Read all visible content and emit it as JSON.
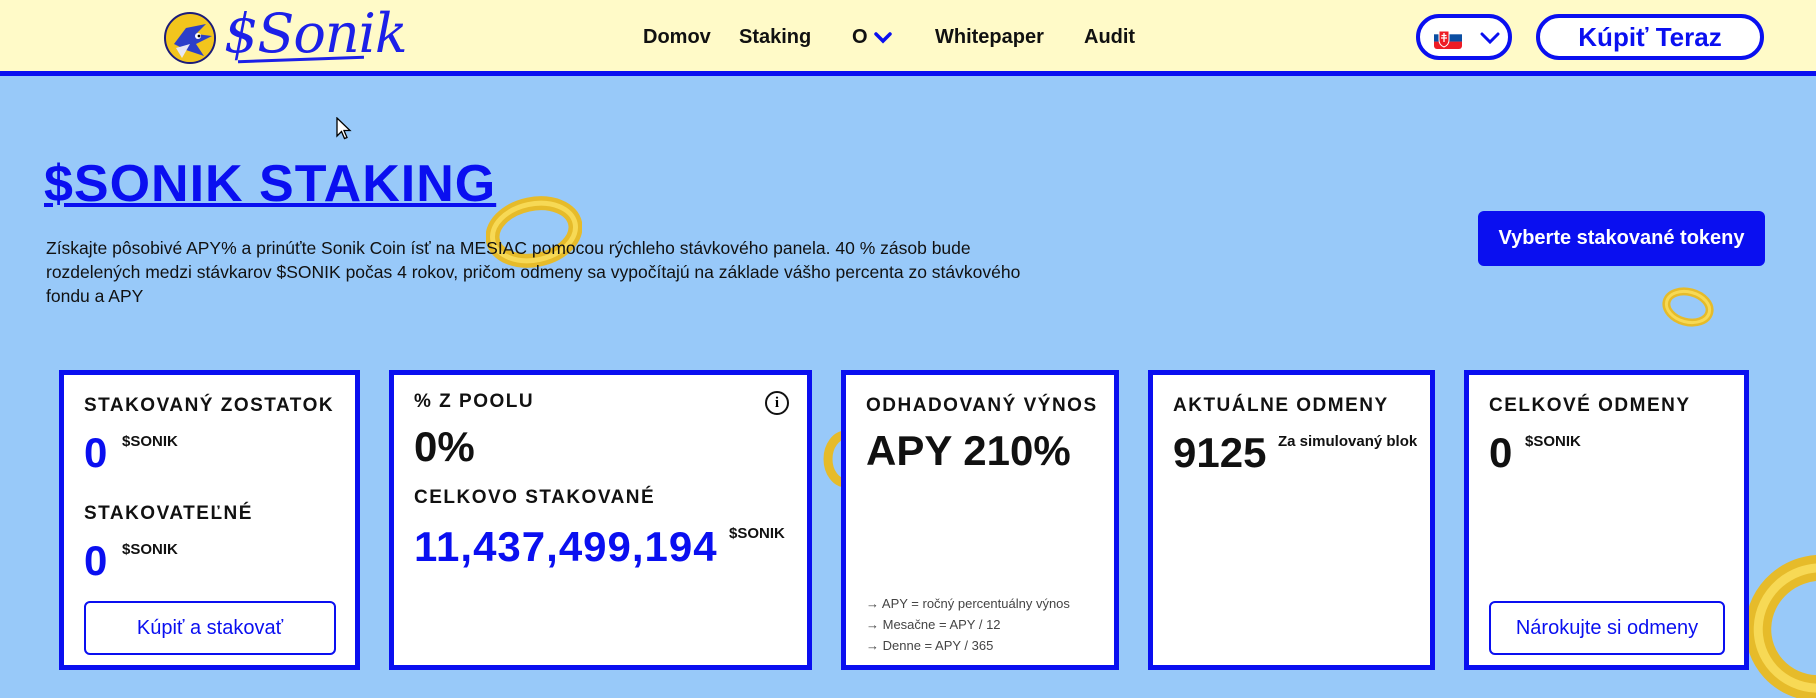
{
  "header": {
    "logo_text": "$Sonik",
    "nav": [
      {
        "label": "Domov"
      },
      {
        "label": "Staking"
      },
      {
        "label": "O"
      },
      {
        "label": "Whitepaper"
      },
      {
        "label": "Audit"
      }
    ],
    "language_flag": "slovakia-flag-icon",
    "buy_label": "Kúpiť Teraz"
  },
  "hero": {
    "title": "$SONIK STAKING",
    "description": "Získajte pôsobivé APY% a prinúťte Sonik Coin ísť na MESIAC pomocou rýchleho stávkového panela. 40 % zásob bude rozdelených medzi stávkarov $SONIK počas 4 rokov, pričom odmeny sa vypočítajú na základe vášho percenta zo stávkového fondu a APY",
    "select_button": "Vyberte stakované tokeny"
  },
  "cards": {
    "staked": {
      "label": "STAKOVANÝ ZOSTATOK",
      "value": "0",
      "unit": "$SONIK",
      "stakeable_label": "STAKOVATEĽNÉ",
      "stakeable_value": "0",
      "stakeable_unit": "$SONIK",
      "button": "Kúpiť a stakovať"
    },
    "pool": {
      "label": "% Z POOLU",
      "value": "0%",
      "total_label": "CELKOVO STAKOVANÉ",
      "total_value": "11,437,499,194",
      "total_unit": "$SONIK"
    },
    "yield": {
      "label": "ODHADOVANÝ VÝNOS",
      "value": "APY 210%",
      "notes": [
        "→ APY = ročný percentuálny výnos",
        "→ Mesačne = APY / 12",
        "→ Denne = APY / 365"
      ]
    },
    "current": {
      "label": "AKTUÁLNE ODMENY",
      "value": "9125",
      "unit": "Za simulovaný blok"
    },
    "total": {
      "label": "CELKOVÉ ODMENY",
      "value": "0",
      "unit": "$SONIK",
      "button": "Nárokujte si odmeny"
    }
  },
  "colors": {
    "accent": "#0a0ff0",
    "header_bg": "#fffac8",
    "page_bg": "#98c9f9",
    "coin": "#f2c51d"
  }
}
